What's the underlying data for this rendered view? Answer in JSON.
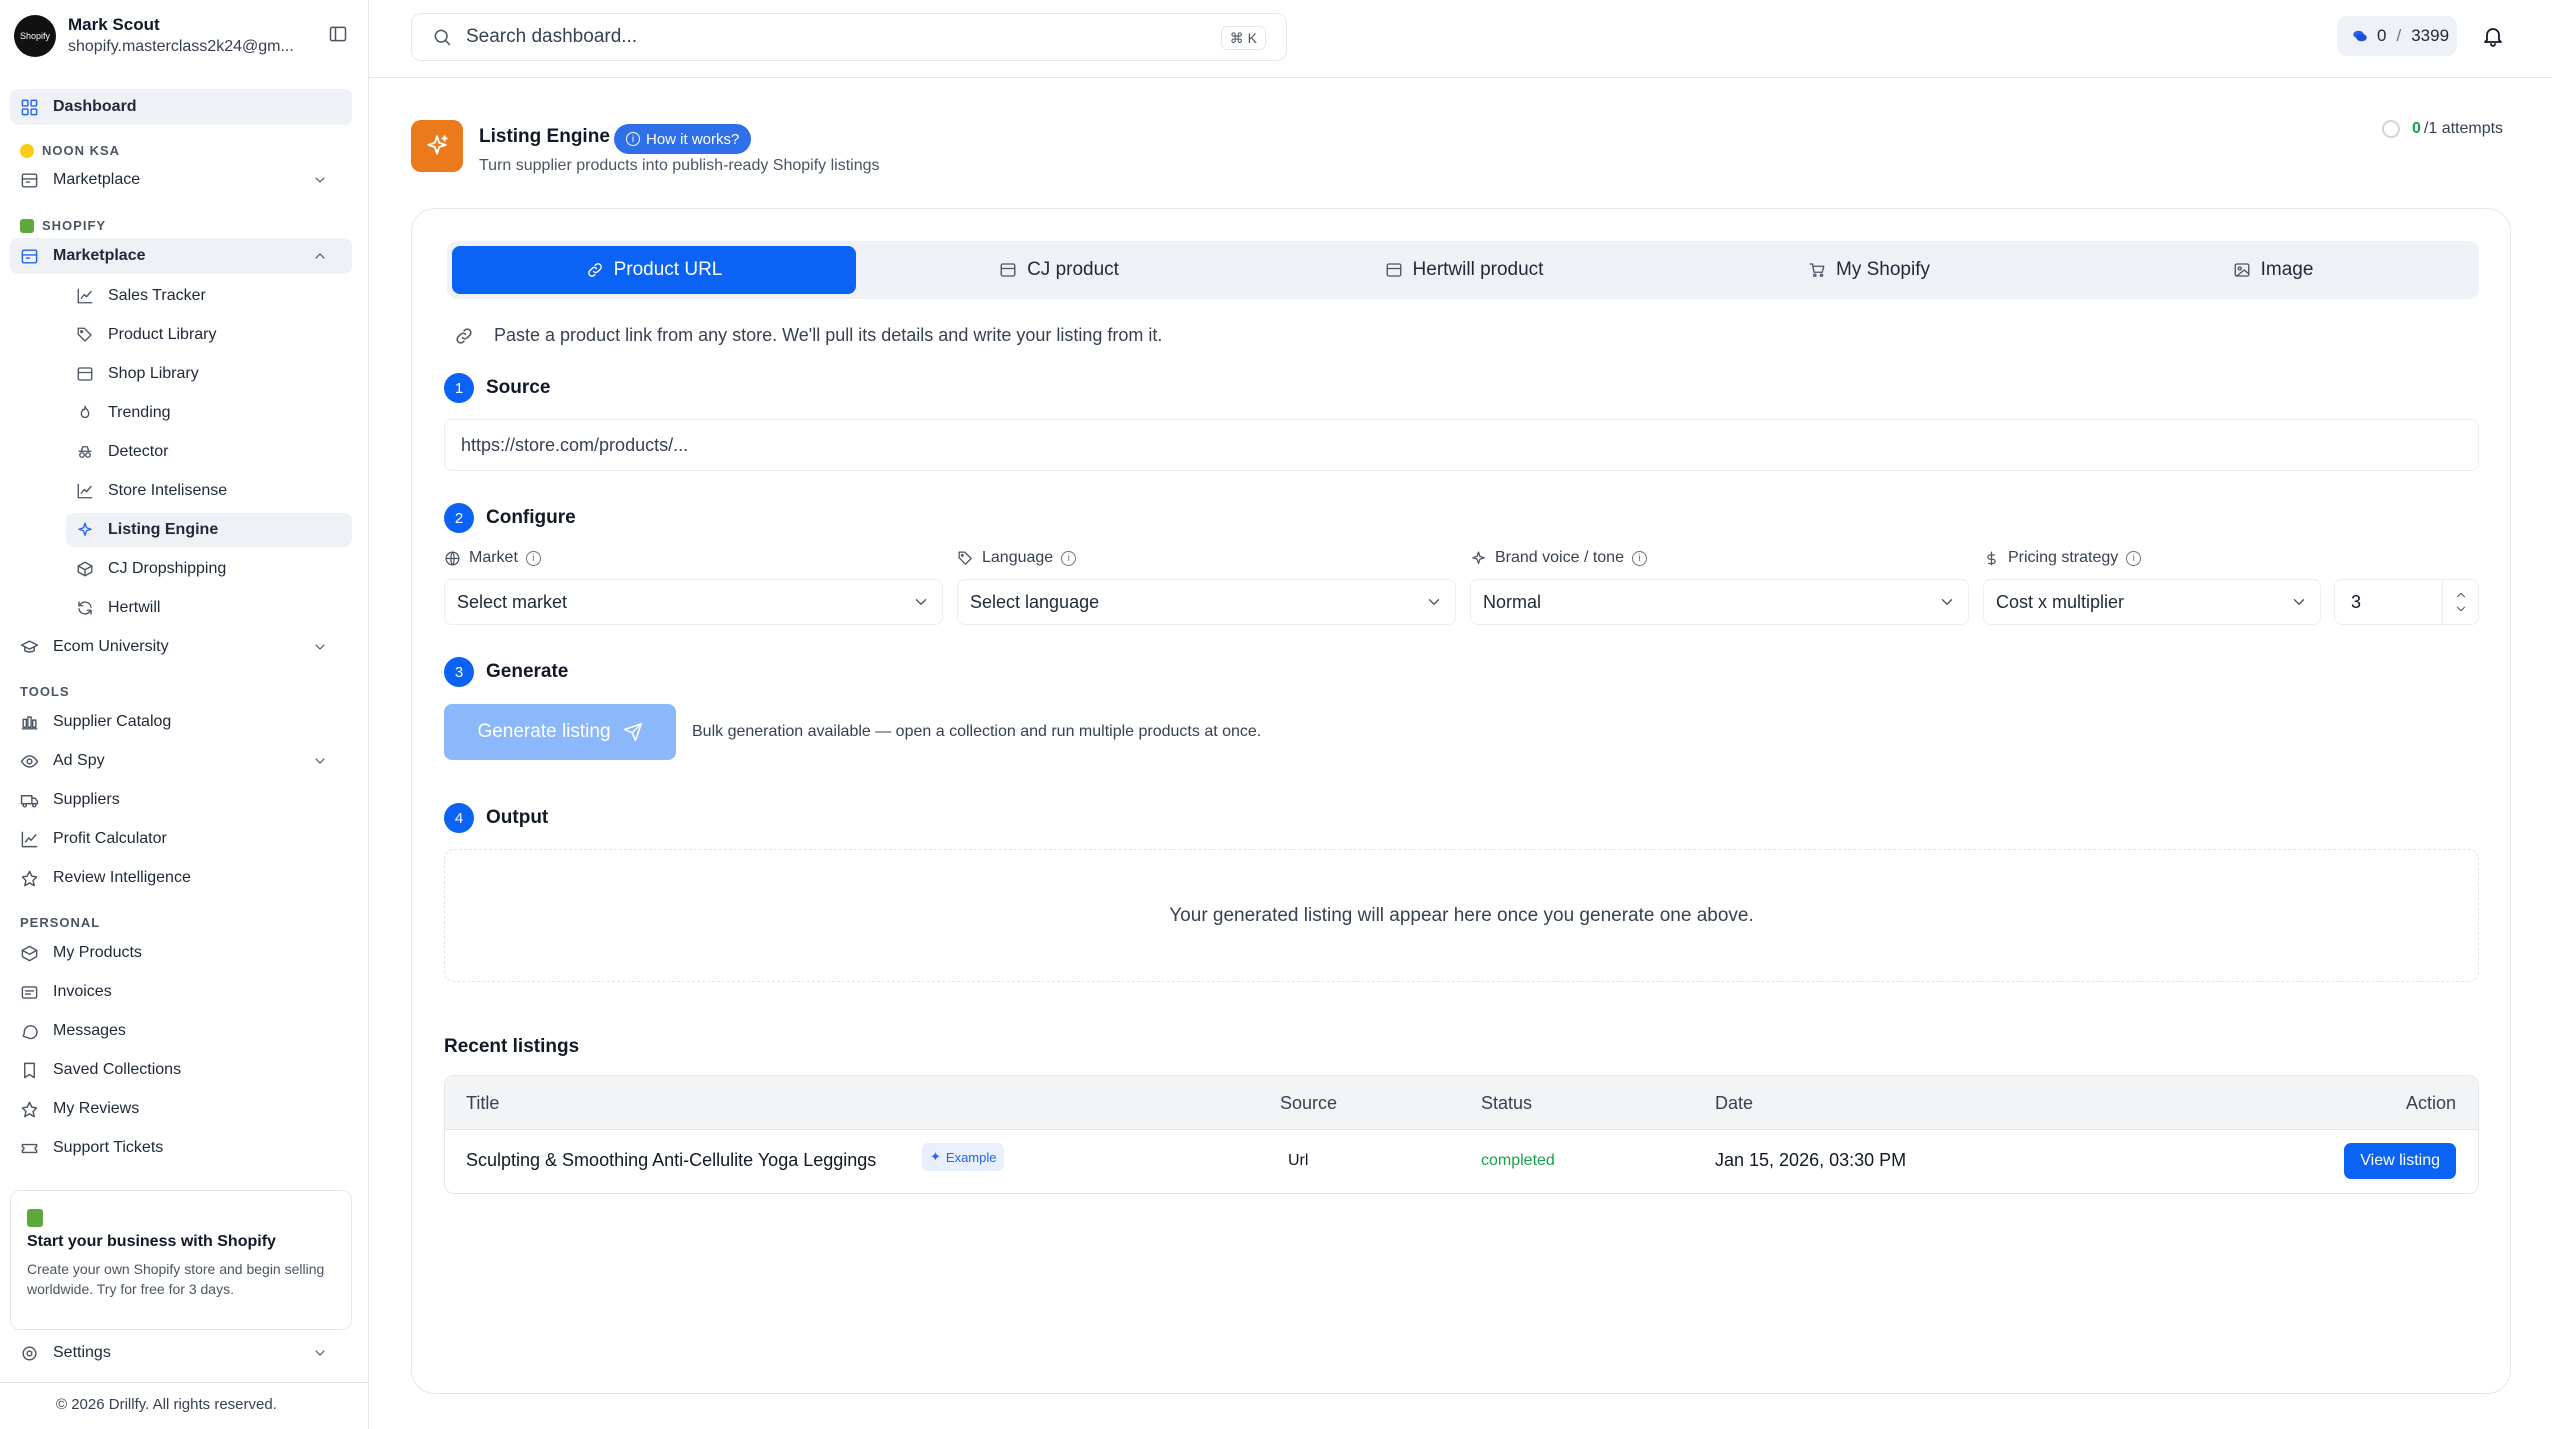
{
  "user": {
    "name": "Mark Scout",
    "email": "shopify.masterclass2k24@gm...",
    "avatar_text": "Shopify"
  },
  "sidebar": {
    "dashboard": "Dashboard",
    "noon_label": "NOON KSA",
    "noon_marketplace": "Marketplace",
    "shopify_label": "SHOPIFY",
    "shopify_marketplace": "Marketplace",
    "sub_items": [
      {
        "label": "Sales Tracker",
        "icon": "line-chart-icon"
      },
      {
        "label": "Product Library",
        "icon": "tag-icon"
      },
      {
        "label": "Shop Library",
        "icon": "store-icon"
      },
      {
        "label": "Trending",
        "icon": "flame-icon"
      },
      {
        "label": "Detector",
        "icon": "spy-icon"
      },
      {
        "label": "Store Intelisense",
        "icon": "line-chart-icon"
      },
      {
        "label": "Listing Engine",
        "icon": "sparkles-icon"
      },
      {
        "label": "CJ Dropshipping",
        "icon": "box-icon"
      },
      {
        "label": "Hertwill",
        "icon": "refresh-icon"
      }
    ],
    "ecom_university": "Ecom University",
    "tools_label": "TOOLS",
    "tools": [
      {
        "label": "Supplier Catalog",
        "icon": "library-icon"
      },
      {
        "label": "Ad Spy",
        "icon": "eye-icon"
      },
      {
        "label": "Suppliers",
        "icon": "truck-icon"
      },
      {
        "label": "Profit Calculator",
        "icon": "line-chart-icon"
      },
      {
        "label": "Review Intelligence",
        "icon": "star-icon"
      }
    ],
    "personal_label": "PERSONAL",
    "personal": [
      {
        "label": "My Products",
        "icon": "box-icon"
      },
      {
        "label": "Invoices",
        "icon": "receipt-icon"
      },
      {
        "label": "Messages",
        "icon": "message-icon"
      },
      {
        "label": "Saved Collections",
        "icon": "bookmark-icon"
      },
      {
        "label": "My Reviews",
        "icon": "star-icon"
      },
      {
        "label": "Support Tickets",
        "icon": "ticket-icon"
      }
    ],
    "promo_title": "Start your business with Shopify",
    "promo_text": "Create your own Shopify store and begin selling worldwide. Try for free for 3 days.",
    "settings": "Settings",
    "copyright": "© 2026 Drillfy. All rights reserved."
  },
  "topbar": {
    "search_placeholder": "Search dashboard...",
    "shortcut": "⌘ K",
    "credits_used": "0",
    "credits_sep": "/",
    "credits_total": "3399"
  },
  "page": {
    "title": "Listing Engine",
    "how_it_works": "How it works?",
    "subtitle": "Turn supplier products into publish-ready Shopify listings",
    "attempts_used": "0",
    "attempts_rest": "/1 attempts"
  },
  "tabs": [
    {
      "label": "Product URL",
      "icon": "link-icon"
    },
    {
      "label": "CJ product",
      "icon": "store-icon"
    },
    {
      "label": "Hertwill product",
      "icon": "store-icon"
    },
    {
      "label": "My Shopify",
      "icon": "cart-icon"
    },
    {
      "label": "Image",
      "icon": "image-icon"
    }
  ],
  "hint": "Paste a product link from any store. We'll pull its details and write your listing from it.",
  "steps": {
    "source": {
      "num": "1",
      "label": "Source"
    },
    "configure": {
      "num": "2",
      "label": "Configure"
    },
    "generate": {
      "num": "3",
      "label": "Generate"
    },
    "output": {
      "num": "4",
      "label": "Output"
    }
  },
  "source_placeholder": "https://store.com/products/...",
  "config": {
    "market_label": "Market",
    "market_value": "Select market",
    "language_label": "Language",
    "language_value": "Select language",
    "brand_label": "Brand voice / tone",
    "brand_value": "Normal",
    "pricing_label": "Pricing strategy",
    "pricing_value": "Cost x multiplier",
    "multiplier": "3"
  },
  "generate": {
    "button": "Generate listing",
    "note": "Bulk generation available — open a collection and run multiple products at once."
  },
  "output_placeholder": "Your generated listing will appear here once you generate one above.",
  "recent": {
    "title": "Recent listings",
    "columns": [
      "Title",
      "Source",
      "Status",
      "Date",
      "Action"
    ],
    "rows": [
      {
        "title": "Sculpting & Smoothing Anti-Cellulite Yoga Leggings",
        "badge": "Example",
        "source": "Url",
        "status": "completed",
        "date": "Jan 15, 2026, 03:30 PM",
        "action": "View listing"
      }
    ]
  },
  "colors": {
    "accent": "#0b63f6",
    "brand_orange": "#ea7a1c",
    "success": "#16a34a"
  }
}
